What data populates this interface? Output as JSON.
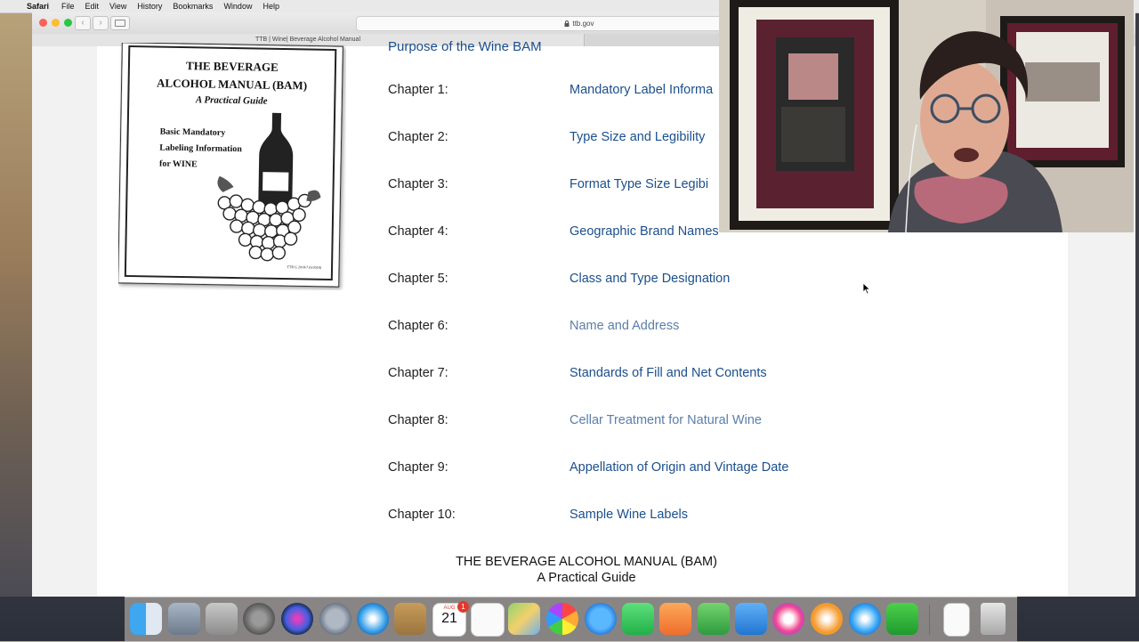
{
  "menubar": {
    "app_name": "Safari",
    "items": [
      "File",
      "Edit",
      "View",
      "History",
      "Bookmarks",
      "Window",
      "Help"
    ]
  },
  "browser": {
    "address": "ttb.gov",
    "tab_title": "TTB | Wine| Beverage Alcohol Manual"
  },
  "page": {
    "cutoff_heading": "Purpose of the Wine BAM",
    "book_cover": {
      "title_line1": "THE BEVERAGE",
      "title_line2": "ALCOHOL MANUAL (BAM)",
      "subtitle": "A Practical Guide",
      "desc_line1": "Basic Mandatory",
      "desc_line2": "Labeling Information",
      "desc_line3": "for WINE",
      "code": "TTB G 2018-7 (6/2018)"
    },
    "chapters": [
      {
        "num": "Chapter 1:",
        "title": "Mandatory Label Informa",
        "visited": false
      },
      {
        "num": "Chapter 2:",
        "title": "Type Size and Legibility",
        "visited": false
      },
      {
        "num": "Chapter 3:",
        "title": "Format Type Size Legibi",
        "visited": false
      },
      {
        "num": "Chapter 4:",
        "title": "Geographic Brand Names",
        "visited": false
      },
      {
        "num": "Chapter 5:",
        "title": "Class and Type Designation",
        "visited": false
      },
      {
        "num": "Chapter 6:",
        "title": "Name and Address",
        "visited": true
      },
      {
        "num": "Chapter 7:",
        "title": "Standards of Fill and Net Contents",
        "visited": false
      },
      {
        "num": "Chapter 8:",
        "title": "Cellar Treatment for Natural Wine",
        "visited": true
      },
      {
        "num": "Chapter 9:",
        "title": "Appellation of Origin and Vintage Date",
        "visited": false
      },
      {
        "num": "Chapter 10:",
        "title": "Sample Wine Labels",
        "visited": false
      }
    ],
    "footer_line1": "THE BEVERAGE ALCOHOL MANUAL (BAM)",
    "footer_line2": "A Practical Guide"
  },
  "dock": {
    "calendar_month": "AUG",
    "calendar_day": "21",
    "calendar_badge": "1",
    "icons": [
      "finder-icon",
      "preview-icon",
      "keychain-icon",
      "system-preferences-icon",
      "siri-icon",
      "launchpad-icon",
      "safari-icon",
      "contacts-icon",
      "calendar-icon",
      "reminders-icon",
      "maps-icon",
      "photos-icon",
      "messages-icon",
      "facetime-icon",
      "pages-icon",
      "numbers-icon",
      "keynote-icon",
      "itunes-icon",
      "ibooks-icon",
      "app-store-icon",
      "camtasia-icon",
      "documents-icon",
      "trash-icon"
    ]
  }
}
